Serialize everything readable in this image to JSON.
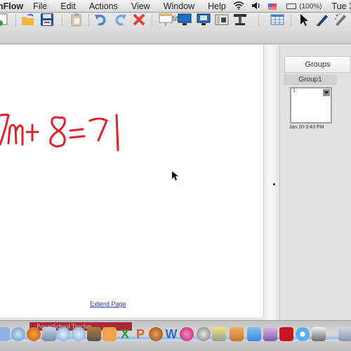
{
  "menubar": {
    "app_name": "nFlow",
    "items": [
      "File",
      "Edit",
      "Actions",
      "View",
      "Window",
      "Help"
    ],
    "status": {
      "wifi_icon": "wifi-icon",
      "volume_icon": "volume-icon",
      "input_flag": "us-flag-icon",
      "battery_icon": "battery-charging-icon",
      "battery_percent": "(100%)",
      "clock": "Tue 3"
    }
  },
  "window": {
    "title": "Untitled"
  },
  "toolbar": {
    "buttons": [
      {
        "name": "new-page-button",
        "icon": "new-page-icon"
      },
      {
        "name": "open-button",
        "icon": "folder-open-icon"
      },
      {
        "name": "save-button",
        "icon": "floppy-disk-icon"
      },
      {
        "name": "paste-button",
        "icon": "clipboard-icon"
      },
      {
        "name": "undo-button",
        "icon": "undo-icon"
      },
      {
        "name": "redo-button",
        "icon": "redo-icon"
      },
      {
        "name": "delete-button",
        "icon": "red-x-icon"
      },
      {
        "name": "presentation-button",
        "icon": "projector-screen-icon"
      },
      {
        "name": "monitor-button",
        "icon": "monitor-icon"
      },
      {
        "name": "monitor-split-button",
        "icon": "monitor-book-icon"
      },
      {
        "name": "camera-button",
        "icon": "camera-icon"
      },
      {
        "name": "text-tool-button",
        "icon": "text-tool-icon"
      },
      {
        "name": "table-button",
        "icon": "table-icon"
      },
      {
        "name": "select-tool-button",
        "icon": "arrow-pointer-icon"
      },
      {
        "name": "pen-tool-button",
        "icon": "pen-icon"
      },
      {
        "name": "magic-pen-button",
        "icon": "magic-wand-icon"
      }
    ]
  },
  "canvas": {
    "handwriting": "7m+8=71",
    "ink_color": "#e0202a",
    "extend_link": "Extend Page"
  },
  "sidebar": {
    "header": "Groups",
    "group_tab": "Group1",
    "pages": [
      {
        "number": "1",
        "timestamp": "Jan 20-3:43 PM"
      }
    ]
  },
  "dock": {
    "banner_text": "PowerSchool Teacher",
    "apps": [
      "finder-icon",
      "safari-icon",
      "firefox-icon",
      "iphoto-icon",
      "ichat-icon",
      "itunes-icon",
      "image-capture-icon",
      "pages-icon",
      "excel-icon",
      "powerpoint-icon",
      "garageband-icon",
      "word-icon",
      "lovecheck-icon",
      "system-preferences-icon",
      "preview-icon",
      "keynote-icon",
      "textedit-icon",
      "iphoto-slideshow-icon",
      "acrobat-icon",
      "dvd-player-icon",
      "scanner-icon",
      "applications-icon"
    ]
  }
}
